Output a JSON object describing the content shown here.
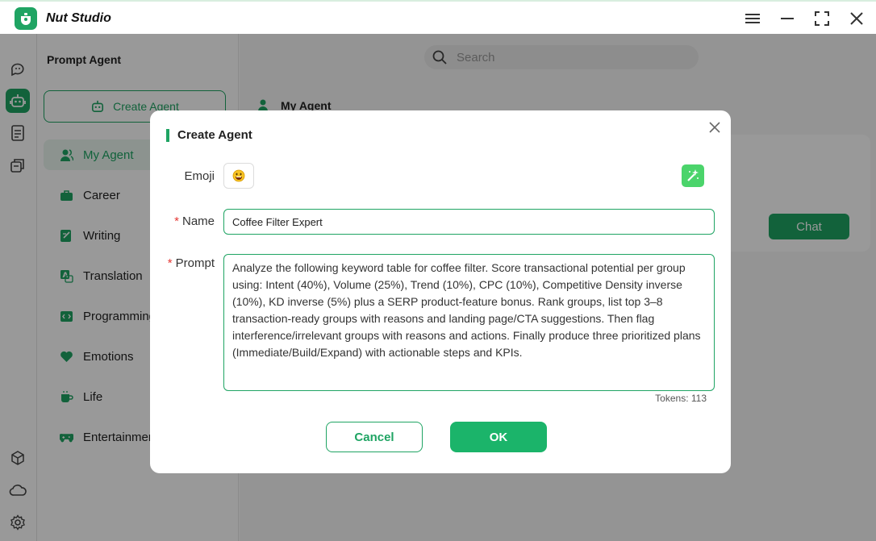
{
  "app": {
    "title": "Nut Studio"
  },
  "rail": {
    "items": [
      {
        "icon": "chat-bubbles-icon"
      },
      {
        "icon": "robot-icon",
        "active": true
      },
      {
        "icon": "document-icon"
      },
      {
        "icon": "library-icon"
      }
    ],
    "bottom_items": [
      {
        "icon": "cube-icon"
      },
      {
        "icon": "cloud-icon"
      },
      {
        "icon": "gear-icon"
      }
    ]
  },
  "sidebar": {
    "title": "Prompt Agent",
    "create_label": "Create Agent",
    "categories": [
      {
        "label": "My Agent",
        "icon": "person-icon"
      },
      {
        "label": "Career",
        "icon": "briefcase-icon"
      },
      {
        "label": "Writing",
        "icon": "pen-icon"
      },
      {
        "label": "Translation",
        "icon": "translate-icon"
      },
      {
        "label": "Programming",
        "icon": "code-icon"
      },
      {
        "label": "Emotions",
        "icon": "heart-icon"
      },
      {
        "label": "Life",
        "icon": "cup-icon"
      },
      {
        "label": "Entertainment",
        "icon": "gamepad-icon"
      }
    ]
  },
  "main": {
    "search_placeholder": "Search",
    "section_title": "My Agent",
    "chat_label": "Chat"
  },
  "modal": {
    "title": "Create Agent",
    "emoji_label": "Emoji",
    "emoji_value": "😀",
    "name_label": "Name",
    "name_value": "Coffee Filter Expert",
    "prompt_label": "Prompt",
    "prompt_value": "Analyze the following keyword table for coffee filter. Score transactional potential per group using: Intent (40%), Volume (25%), Trend (10%), CPC (10%), Competitive Density inverse (10%), KD inverse (5%) plus a SERP product-feature bonus. Rank groups, list top 3–8 transaction-ready groups with reasons and landing page/CTA suggestions. Then flag interference/irrelevant groups with reasons and actions. Finally produce three prioritized plans (Immediate/Build/Expand) with actionable steps and KPIs.",
    "tokens_text": "Tokens: 113",
    "cancel_label": "Cancel",
    "ok_label": "OK",
    "required_mark": "*"
  },
  "colors": {
    "accent": "#1fa463",
    "ok": "#1bb46a",
    "required": "#e53935"
  }
}
